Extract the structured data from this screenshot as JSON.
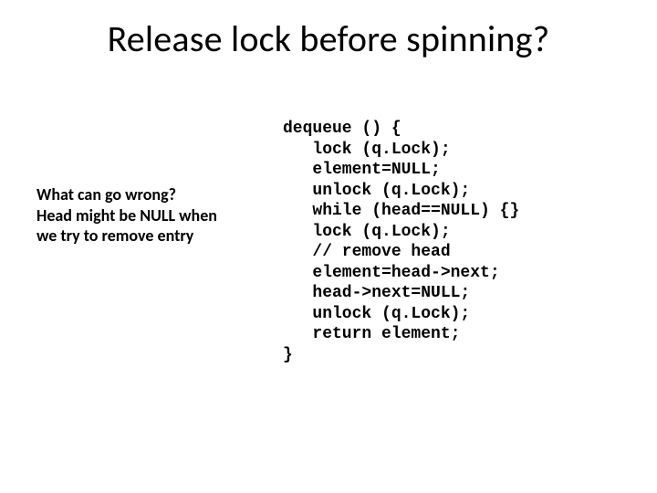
{
  "title": "Release lock before spinning?",
  "note_lines": [
    "What can go wrong?",
    "Head might be NULL when",
    "we try to remove entry"
  ],
  "code": "dequeue () {\n   lock (q.Lock);\n   element=NULL;\n   unlock (q.Lock);\n   while (head==NULL) {}\n   lock (q.Lock);\n   // remove head\n   element=head->next;\n   head->next=NULL;\n   unlock (q.Lock);\n   return element;\n}"
}
